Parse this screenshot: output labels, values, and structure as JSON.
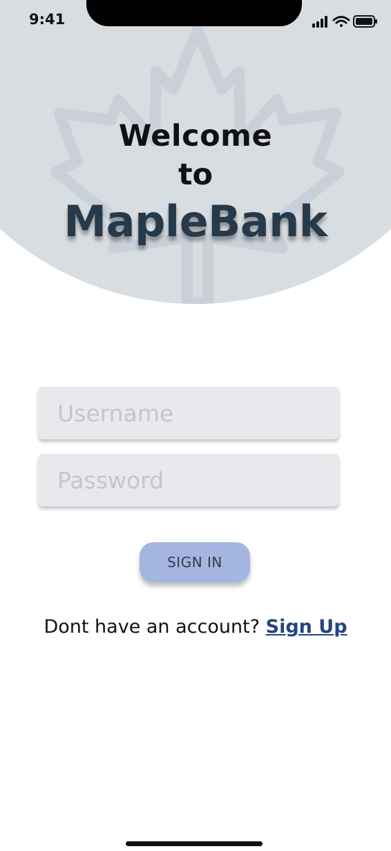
{
  "status_bar": {
    "time": "9:41",
    "icons": [
      "cellular-signal-icon",
      "wifi-icon",
      "battery-icon"
    ]
  },
  "header": {
    "welcome_line1": "Welcome",
    "welcome_line2": "to",
    "brand": "MapleBank",
    "background_icon": "maple-leaf-icon"
  },
  "form": {
    "username_placeholder": "Username",
    "username_value": "",
    "password_placeholder": "Password",
    "password_value": "",
    "signin_label": "SIGN IN"
  },
  "footer": {
    "prompt": "Dont have an account?",
    "signup_label": "Sign Up"
  },
  "colors": {
    "hero_background": "#d8dde1",
    "brand_text": "#263a4b",
    "field_background": "#e8e9ed",
    "button_background": "#a4b5e0",
    "link": "#234583"
  }
}
